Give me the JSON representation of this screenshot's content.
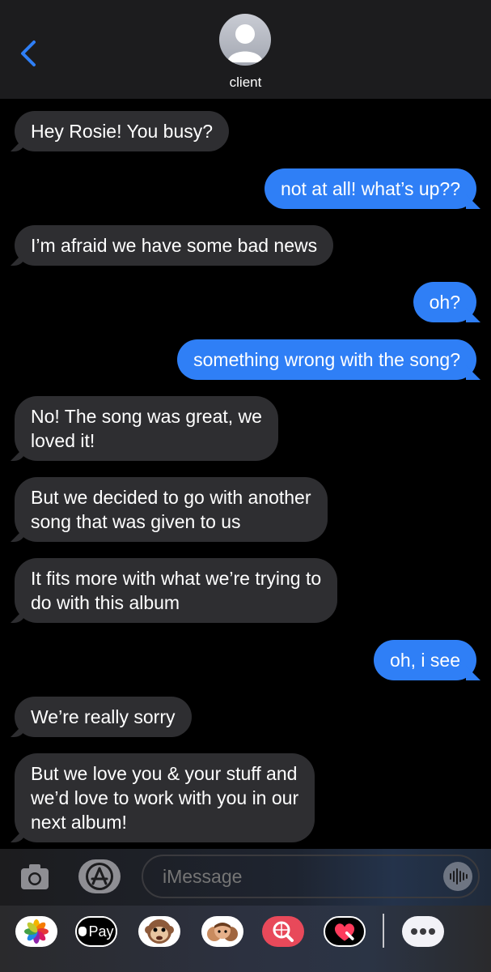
{
  "header": {
    "contact_name": "client",
    "back_icon": "chevron-left-icon",
    "accent_color": "#2f7ff6"
  },
  "messages": [
    {
      "direction": "received",
      "text": "Hey Rosie! You busy?"
    },
    {
      "direction": "sent",
      "text": "not at all! what’s up??"
    },
    {
      "direction": "received",
      "text": "I’m afraid we have some bad news"
    },
    {
      "direction": "sent",
      "text": "oh?"
    },
    {
      "direction": "sent",
      "text": "something wrong with the song?"
    },
    {
      "direction": "received",
      "text": "No! The song was great, we\nloved it!"
    },
    {
      "direction": "received",
      "text": "But we decided to go with another\nsong that was given to us"
    },
    {
      "direction": "received",
      "text": "It fits more with what we’re trying to\ndo with this album"
    },
    {
      "direction": "sent",
      "text": "oh, i see"
    },
    {
      "direction": "received",
      "text": "We’re really sorry"
    },
    {
      "direction": "received",
      "text": "But we love you & your stuff and\nwe’d love to work with you in our\nnext album!"
    }
  ],
  "compose": {
    "placeholder": "iMessage",
    "camera_icon": "camera-icon",
    "appstore_icon": "app-store-icon",
    "audio_icon": "audio-waveform-icon"
  },
  "app_drawer": {
    "apps": [
      {
        "name": "photos-app-icon"
      },
      {
        "name": "apple-pay-app-icon",
        "label": "Pay"
      },
      {
        "name": "animoji-app-icon"
      },
      {
        "name": "memoji-app-icon"
      },
      {
        "name": "image-search-app-icon"
      },
      {
        "name": "digital-touch-app-icon"
      },
      {
        "name": "more-apps-icon"
      }
    ]
  }
}
